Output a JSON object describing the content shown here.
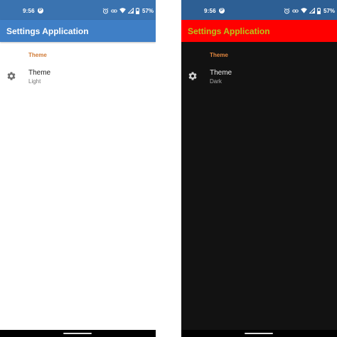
{
  "screens": [
    {
      "variant": "light",
      "status": {
        "time": "9:56",
        "badge": "P",
        "battery": "57%"
      },
      "app_title": "Settings Application",
      "category": "Theme",
      "preference": {
        "title": "Theme",
        "summary": "Light",
        "icon": "gear-icon"
      },
      "colors": {
        "appbar": "#3f7fc6",
        "appbar_text": "#ffffff",
        "background": "#ffffff",
        "accent": "#d07a35"
      }
    },
    {
      "variant": "dark",
      "status": {
        "time": "9:56",
        "badge": "P",
        "battery": "57%"
      },
      "app_title": "Settings Application",
      "category": "Theme",
      "preference": {
        "title": "Theme",
        "summary": "Dark",
        "icon": "gear-icon"
      },
      "colors": {
        "appbar": "#ff0000",
        "appbar_text": "#b8c61a",
        "background": "#121212",
        "accent": "#e2873f"
      }
    }
  ]
}
